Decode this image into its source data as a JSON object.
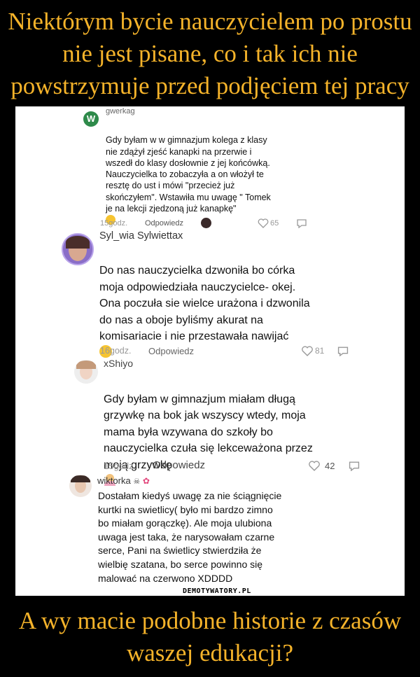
{
  "header": {
    "title": "Niektórym bycie nauczycielem po prostu nie jest pisane, co i tak ich nie powstrzymuje przed podjęciem tej pracy"
  },
  "comments": [
    {
      "avatar_letter": "W",
      "username": "gwerkag",
      "text": "Gdy byłam w w gimnazjum kolega z klasy\nnie zdążył zjeść kanapki na przerwie i\nwszedł do klasy dosłownie z jej końcówką.\nNauczycielka to zobaczyła a on włożył te\nresztę do ust i mówi \"przecież już\nskończyłem\". Wstawiła mu uwagę \" Tomek\nje na lekcji zjedzoną już kanapkę\"",
      "time": "15godz.",
      "reply_label": "Odpowiedz",
      "likes": "65"
    },
    {
      "username": "Syl_wia Sylwiettax",
      "text": "Do nas nauczycielka dzwoniła bo córka\nmoja odpowiedziała nauczycielce- okej.\nOna poczuła sie wielce urażona i dzwonila\ndo nas a oboje byliśmy akurat na\nkomisariacie i nie przestawała nawijać",
      "time": "16godz.",
      "reply_label": "Odpowiedz",
      "likes": "81"
    },
    {
      "username": "xShiyo",
      "text": "Gdy byłam w gimnazjum miałam długą\ngrzywkę na bok jak wszyscy wtedy, moja\nmama była wzywana do szkoły bo\nnauczycielka czuła się lekceważona przez\nmoją grzywkę",
      "time": "15godz.",
      "reply_label": "Odpowiedz",
      "likes": "42"
    },
    {
      "username": "wiktorka",
      "text": "Dostałam kiedyś uwagę za nie ściągnięcie\nkurtki na swietlicy( było mi bardzo zimno\nbo miałam gorączkę). Ale moja ulubiona\nuwaga jest taka, że narysowałam czarne\nserce, Pani na świetlicy stwierdziła że\nwielbię szatana, bo serce powinno się\nmalować na czerwono XDDDD"
    }
  ],
  "watermark": "DEMOTYWATORY.PL",
  "footer": {
    "caption": "A wy macie podobne historie z czasów waszej edukacji?"
  },
  "colors": {
    "accent": "#f5b32a",
    "background": "#000000",
    "panel": "#ffffff",
    "avatar_green": "#2e8a4a"
  },
  "icons": [
    "laughing-emoji-icon",
    "heart-icon",
    "reply-icon",
    "woman-emoji-icon",
    "skull-icon",
    "bow-icon"
  ]
}
